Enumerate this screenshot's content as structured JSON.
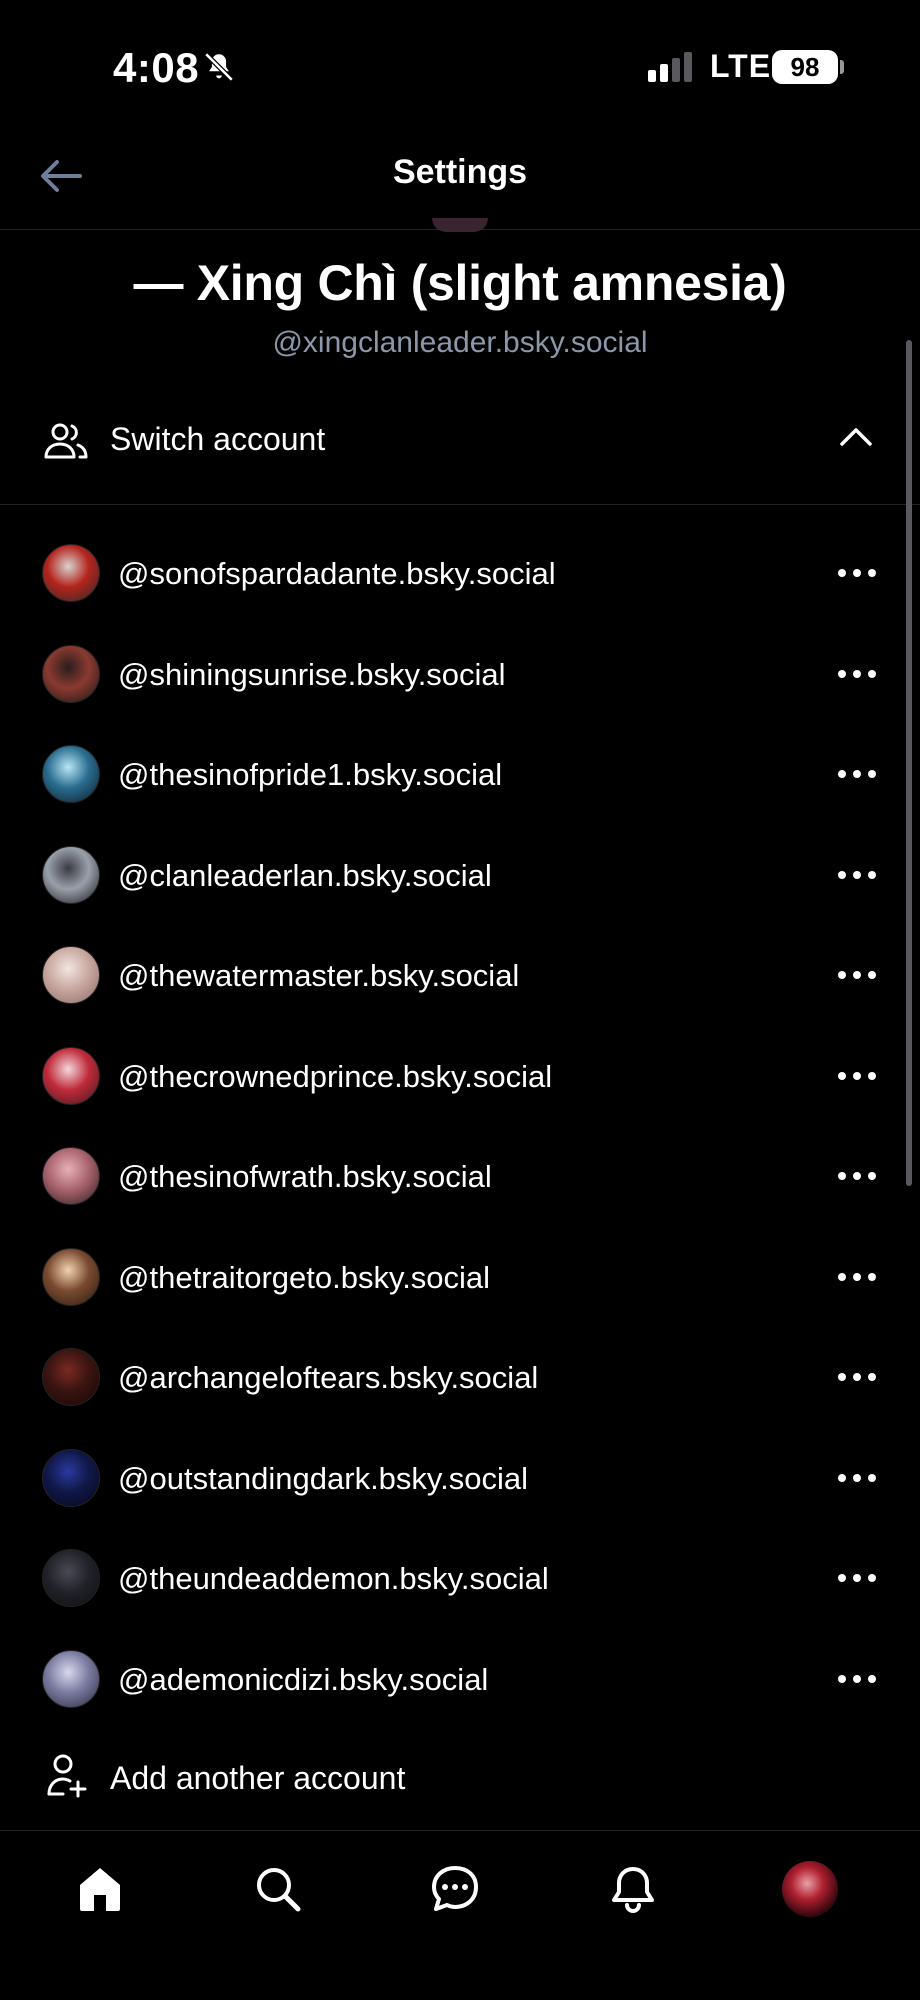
{
  "status_bar": {
    "time": "4:08",
    "network": "LTE",
    "battery": "98"
  },
  "header": {
    "title": "Settings"
  },
  "profile": {
    "display_name": "— Xing Chì (slight amnesia)",
    "handle": "@xingclanleader.bsky.social"
  },
  "switch_account": {
    "label": "Switch account",
    "icon": "users-icon",
    "expanded": true
  },
  "accounts": [
    {
      "handle": "@sonofspardadante.bsky.social",
      "avatar_colors": [
        "#d8d3d0",
        "#b3241c",
        "#2a2a2a"
      ]
    },
    {
      "handle": "@shiningsunrise.bsky.social",
      "avatar_colors": [
        "#2a1d1d",
        "#8a3a30",
        "#1a1414"
      ]
    },
    {
      "handle": "@thesinofpride1.bsky.social",
      "avatar_colors": [
        "#b9e6f5",
        "#2a6d90",
        "#0b1a24"
      ]
    },
    {
      "handle": "@clanleaderlan.bsky.social",
      "avatar_colors": [
        "#3a3a44",
        "#9aa0aa",
        "#15151a"
      ]
    },
    {
      "handle": "@thewatermaster.bsky.social",
      "avatar_colors": [
        "#f1e6e0",
        "#c9a8a0",
        "#8a6a6a"
      ]
    },
    {
      "handle": "@thecrownedprince.bsky.social",
      "avatar_colors": [
        "#f3d7dc",
        "#c02a3a",
        "#3a1a20"
      ]
    },
    {
      "handle": "@thesinofwrath.bsky.social",
      "avatar_colors": [
        "#e8b0b8",
        "#a9646e",
        "#2a1a1c"
      ]
    },
    {
      "handle": "@thetraitorgeto.bsky.social",
      "avatar_colors": [
        "#f2d2b0",
        "#7a4a30",
        "#2a1a10"
      ]
    },
    {
      "handle": "@archangeloftears.bsky.social",
      "avatar_colors": [
        "#7a2a22",
        "#3a1410",
        "#150606"
      ]
    },
    {
      "handle": "@outstandingdark.bsky.social",
      "avatar_colors": [
        "#2a3aa0",
        "#101848",
        "#05061a"
      ]
    },
    {
      "handle": "@theundeaddemon.bsky.social",
      "avatar_colors": [
        "#4a4a55",
        "#22222a",
        "#0c0c10"
      ]
    },
    {
      "handle": "@ademonicdizi.bsky.social",
      "avatar_colors": [
        "#d8d8ee",
        "#7a7aa0",
        "#2a2a3a"
      ]
    }
  ],
  "add_account": {
    "label": "Add another account",
    "icon": "user-plus-icon"
  },
  "tabbar": {
    "items": [
      {
        "name": "home",
        "icon": "home-icon",
        "active": true
      },
      {
        "name": "search",
        "icon": "search-icon"
      },
      {
        "name": "chat",
        "icon": "chat-icon"
      },
      {
        "name": "notifications",
        "icon": "bell-icon"
      },
      {
        "name": "profile",
        "icon": "avatar"
      }
    ]
  },
  "colors": {
    "background": "#000000",
    "text": "#ffffff",
    "muted": "#8b98aa",
    "divider": "#1f2328",
    "back_arrow": "#6f7f99"
  }
}
